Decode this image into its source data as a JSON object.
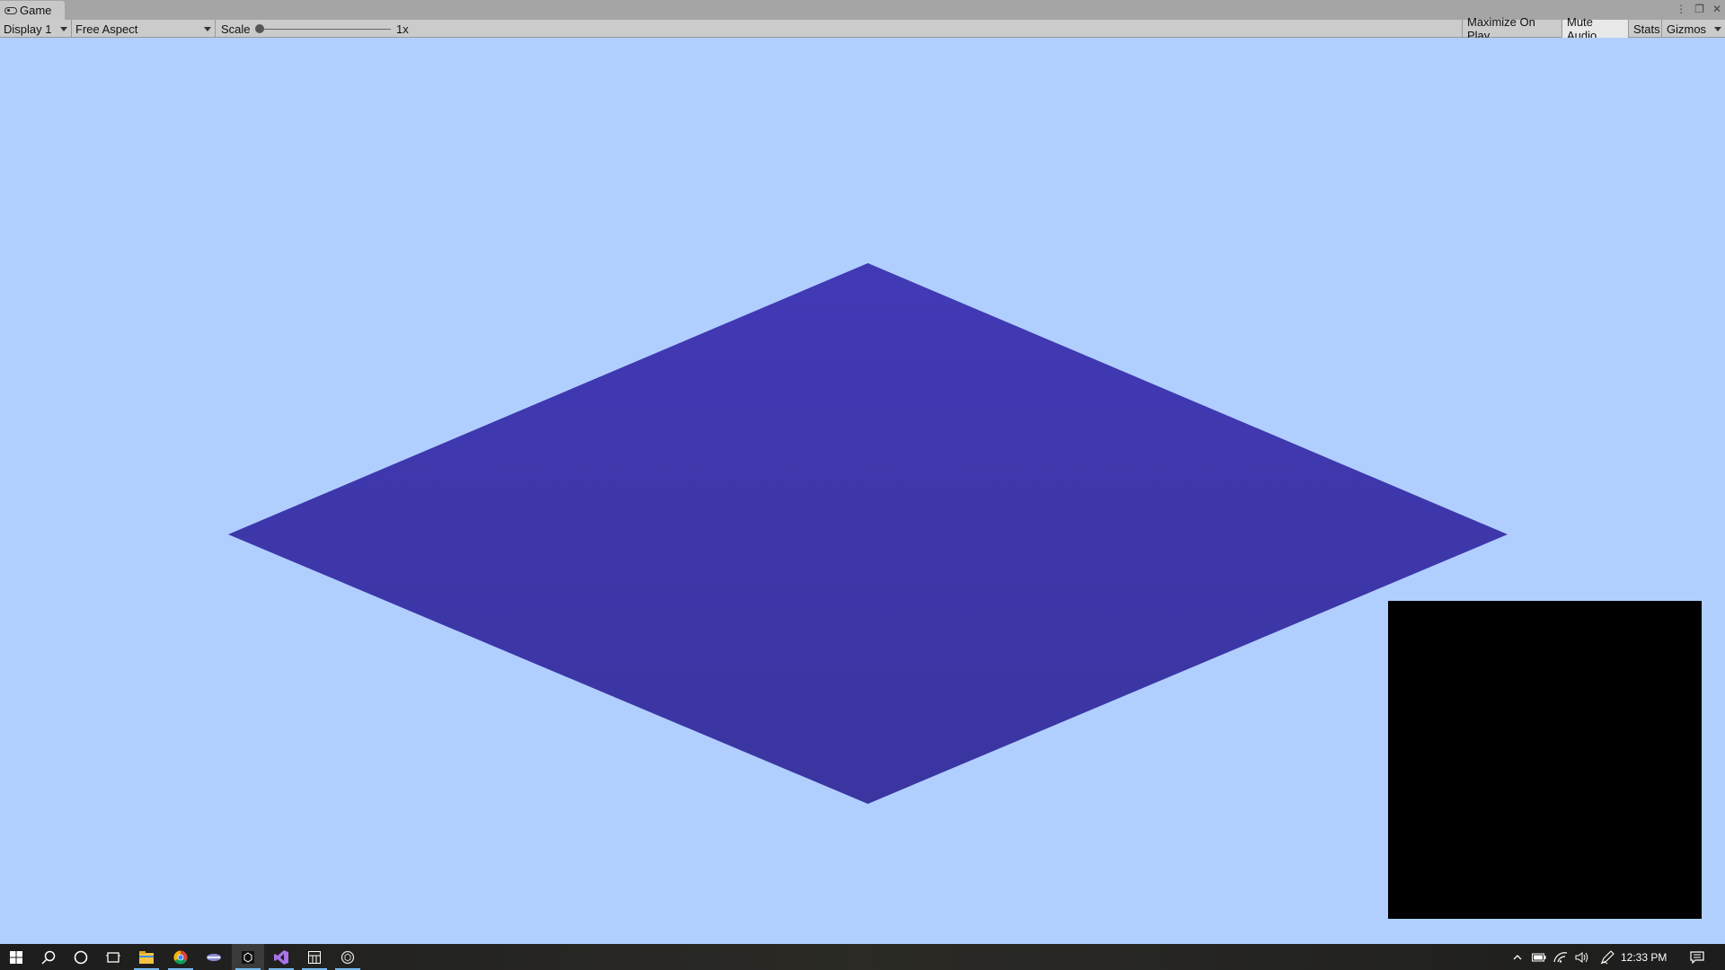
{
  "tab": {
    "title": "Game",
    "icon": "gamepad-icon"
  },
  "window_controls": [
    "kebab-menu-icon",
    "maximize-icon",
    "close-icon"
  ],
  "toolbar": {
    "display": "Display 1",
    "aspect": "Free Aspect",
    "scale_label": "Scale",
    "scale_value": "1x",
    "scale_slider_fraction": 0.0,
    "maximize_on_play": "Maximize On Play",
    "mute_audio": "Mute Audio",
    "mute_audio_active": true,
    "stats": "Stats",
    "gizmos": "Gizmos"
  },
  "scene": {
    "background_color": "#b0cfff",
    "plane_color_top": "#4239b5",
    "plane_color_bottom": "#3a35a0",
    "minimap_color": "#000000"
  },
  "taskbar": {
    "items": [
      {
        "name": "start-icon"
      },
      {
        "name": "search-icon"
      },
      {
        "name": "cortana-icon"
      },
      {
        "name": "task-view-icon"
      },
      {
        "name": "file-explorer-icon",
        "running": true
      },
      {
        "name": "chrome-icon",
        "running": true
      },
      {
        "name": "app-icon",
        "running": false
      },
      {
        "name": "unity-icon",
        "running": true,
        "focused": true
      },
      {
        "name": "visual-studio-icon",
        "running": true
      },
      {
        "name": "calculator-icon",
        "running": true
      },
      {
        "name": "unity-hub-icon",
        "running": true
      }
    ],
    "tray_icons": [
      "chevron-up-icon",
      "battery-icon",
      "wifi-icon",
      "volume-icon",
      "pen-icon"
    ],
    "clock": "12:33 PM",
    "notification_icon": "notification-icon"
  }
}
